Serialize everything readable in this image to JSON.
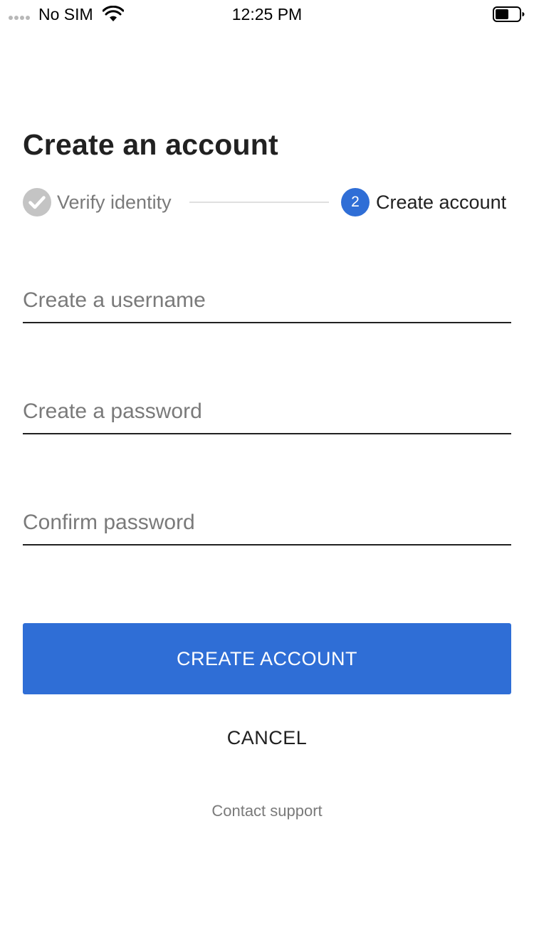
{
  "status_bar": {
    "carrier": "No SIM",
    "time": "12:25 PM",
    "signal_icon": "signal-dots-icon",
    "wifi_icon": "wifi-icon",
    "battery_icon": "battery-icon"
  },
  "title": "Create an account",
  "stepper": {
    "steps": [
      {
        "label": "Verify identity",
        "state": "completed",
        "icon": "check-circle-icon"
      },
      {
        "label": "Create account",
        "state": "active",
        "number": "2"
      }
    ]
  },
  "form": {
    "username": {
      "placeholder": "Create a username",
      "value": ""
    },
    "password": {
      "placeholder": "Create a password",
      "value": ""
    },
    "confirm_password": {
      "placeholder": "Confirm password",
      "value": ""
    }
  },
  "actions": {
    "primary_label": "CREATE ACCOUNT",
    "cancel_label": "CANCEL",
    "support_label": "Contact support"
  },
  "colors": {
    "accent": "#2f6ed6",
    "text_primary": "#212121",
    "text_secondary": "#7a7a7a",
    "completed_step": "#c4c4c4"
  }
}
